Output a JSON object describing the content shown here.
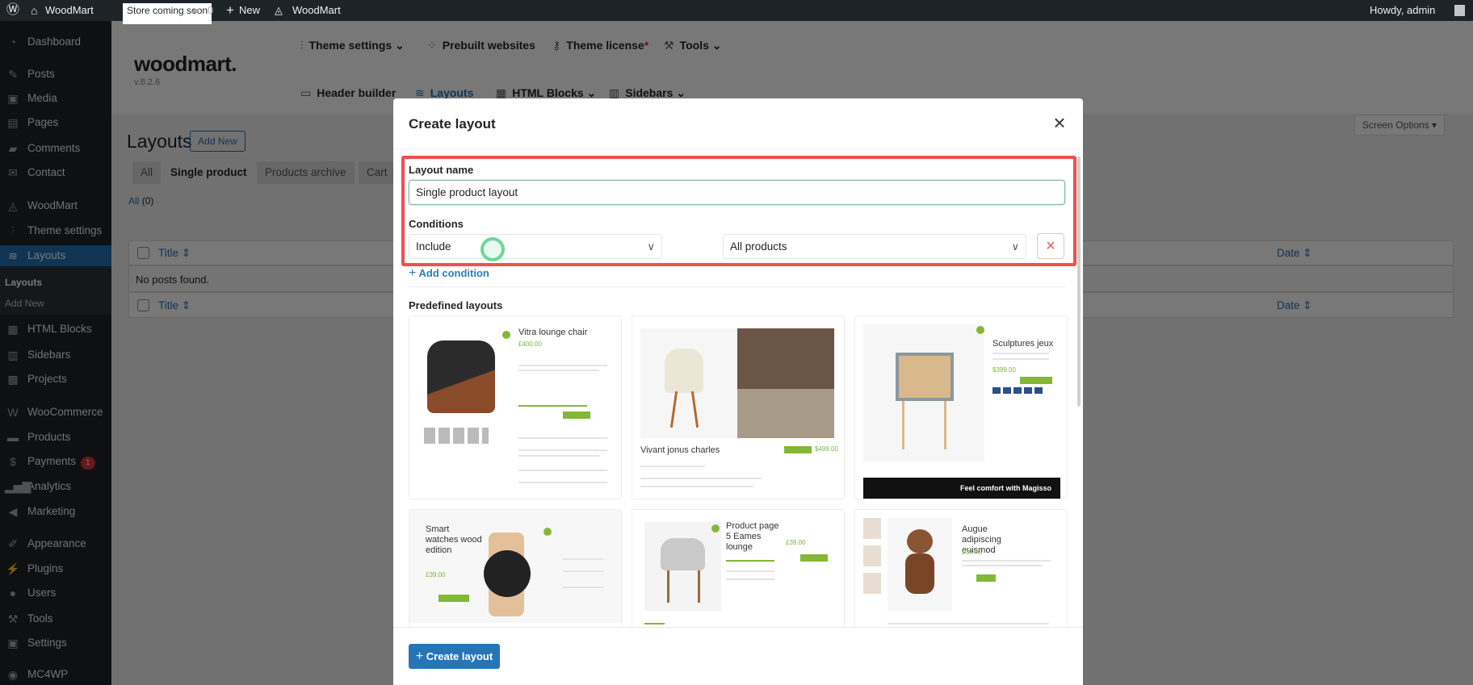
{
  "adminbar": {
    "site_name": "WoodMart",
    "store_badge": "Store coming soon",
    "comments_count": "0",
    "new_label": "New",
    "woodmart_label": "WoodMart",
    "howdy": "Howdy, admin"
  },
  "sidebar": {
    "items": [
      {
        "label": "Dashboard",
        "icon": "dashboard-icon"
      },
      {
        "label": "Posts",
        "icon": "pin-icon"
      },
      {
        "label": "Media",
        "icon": "media-icon"
      },
      {
        "label": "Pages",
        "icon": "pages-icon"
      },
      {
        "label": "Comments",
        "icon": "comment-icon"
      },
      {
        "label": "Contact",
        "icon": "mail-icon"
      },
      {
        "label": "WoodMart",
        "icon": "woodmart-icon"
      },
      {
        "label": "Theme settings",
        "icon": "sliders-icon"
      },
      {
        "label": "Layouts",
        "icon": "layers-icon"
      },
      {
        "label": "HTML Blocks",
        "icon": "html-block-icon"
      },
      {
        "label": "Sidebars",
        "icon": "sidebar-icon"
      },
      {
        "label": "Projects",
        "icon": "briefcase-icon"
      },
      {
        "label": "WooCommerce",
        "icon": "woo-icon"
      },
      {
        "label": "Products",
        "icon": "archive-icon"
      },
      {
        "label": "Payments",
        "icon": "dollar-icon",
        "badge": "1"
      },
      {
        "label": "Analytics",
        "icon": "bar-chart-icon"
      },
      {
        "label": "Marketing",
        "icon": "megaphone-icon"
      },
      {
        "label": "Appearance",
        "icon": "brush-icon"
      },
      {
        "label": "Plugins",
        "icon": "plug-icon"
      },
      {
        "label": "Users",
        "icon": "user-icon"
      },
      {
        "label": "Tools",
        "icon": "wrench-icon"
      },
      {
        "label": "Settings",
        "icon": "settings-icon"
      },
      {
        "label": "MC4WP",
        "icon": "mc4wp-icon"
      }
    ],
    "submenu": [
      "Layouts",
      "Add New"
    ]
  },
  "woodmart_header": {
    "logo": "woodmart.",
    "version": "v.8.2.6",
    "nav_top": [
      "Theme settings",
      "Prebuilt websites",
      "Theme license",
      "Tools"
    ],
    "nav_bottom": [
      "Header builder",
      "Layouts",
      "HTML Blocks",
      "Sidebars"
    ]
  },
  "page": {
    "title": "Layouts",
    "add_new": "Add New",
    "screen_options": "Screen Options",
    "tabs": [
      "All",
      "Single product",
      "Products archive",
      "Cart"
    ],
    "filter_all": "All",
    "filter_count": "(0)",
    "col_title": "Title",
    "col_date": "Date",
    "empty": "No posts found."
  },
  "modal": {
    "title": "Create layout",
    "layout_name_label": "Layout name",
    "layout_name_value": "Single product layout",
    "conditions_label": "Conditions",
    "condition_type": "Include",
    "condition_target": "All products",
    "add_condition": "Add condition",
    "predefined_label": "Predefined layouts",
    "create_button": "Create layout",
    "templates": [
      {
        "title": "Vitra lounge chair",
        "price": "£400.00"
      },
      {
        "title": "Vivant jonus charles",
        "price": "$499.00"
      },
      {
        "title": "Sculptures jeux",
        "price": "$399.00",
        "banner": "Feel comfort with Magisso"
      },
      {
        "title": "Smart watches wood edition",
        "price": "£39.00"
      },
      {
        "title": "Product page 5 Eames lounge",
        "price": "£39.00"
      },
      {
        "title": "Augue adipiscing euismod",
        "price": "£39.00"
      }
    ]
  },
  "colors": {
    "accent": "#2271b1",
    "highlight": "#f24f4f",
    "button": "#2775b6",
    "green": "#83b735"
  }
}
